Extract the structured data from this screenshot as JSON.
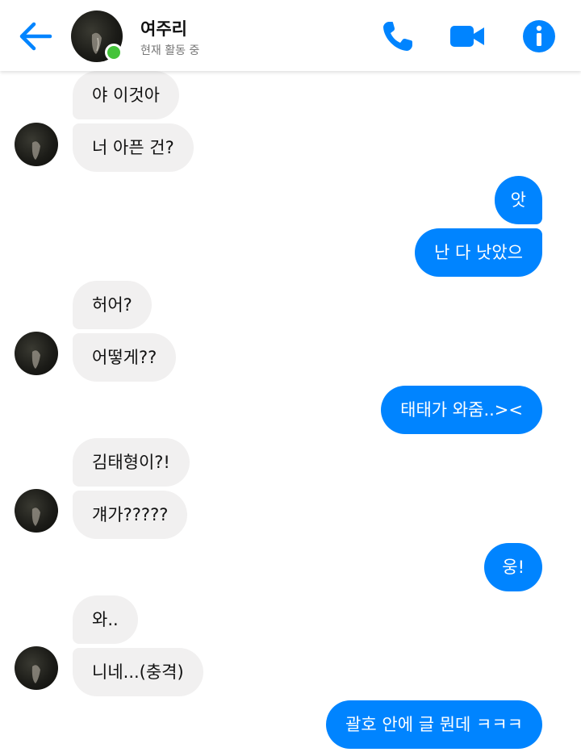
{
  "header": {
    "contact_name": "여주리",
    "status": "현재 활동 중",
    "icons": {
      "back": "arrow-left-icon",
      "phone": "phone-icon",
      "video": "video-camera-icon",
      "info": "info-icon"
    }
  },
  "colors": {
    "accent": "#0084ff",
    "incoming_bubble": "#f1f0f0",
    "online": "#44c33a"
  },
  "messages": [
    {
      "direction": "in",
      "text": "야 이것아"
    },
    {
      "direction": "in",
      "text": "너 아픈 건?"
    },
    {
      "direction": "out",
      "text": "앗"
    },
    {
      "direction": "out",
      "text": "난 다 낫았으"
    },
    {
      "direction": "in",
      "text": "허어?"
    },
    {
      "direction": "in",
      "text": "어떻게??"
    },
    {
      "direction": "out",
      "text": "태태가 와줌..><"
    },
    {
      "direction": "in",
      "text": "김태형이?!"
    },
    {
      "direction": "in",
      "text": "걔가?????"
    },
    {
      "direction": "out",
      "text": "웅!"
    },
    {
      "direction": "in",
      "text": "와.."
    },
    {
      "direction": "in",
      "text": "니네...(충격)"
    },
    {
      "direction": "out",
      "text": "괄호 안에 글 뭔데 ㅋㅋㅋ"
    }
  ]
}
